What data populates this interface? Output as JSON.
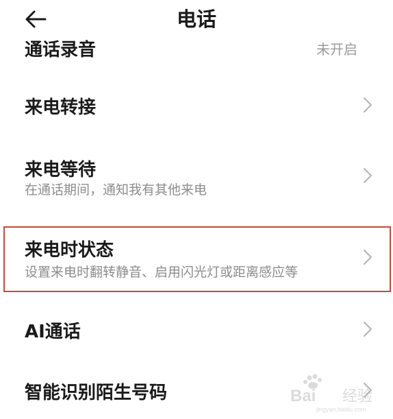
{
  "header": {
    "title": "电话"
  },
  "partial_item": {
    "label": "通话录音",
    "value": "未开启"
  },
  "items": [
    {
      "title": "来电转接",
      "subtitle": ""
    },
    {
      "title": "来电等待",
      "subtitle": "在通话期间，通知我有其他来电"
    },
    {
      "title": "来电时状态",
      "subtitle": "设置来电时翻转静音、启用闪光灯或距离感应等"
    },
    {
      "title": "AI通话",
      "subtitle": ""
    },
    {
      "title": "智能识别陌生号码",
      "subtitle": ""
    }
  ],
  "watermark": {
    "brand": "Bai",
    "suffix": "经验",
    "url": "jingyan.baidu.com"
  },
  "colors": {
    "highlight_border": "#c8483a",
    "title_text": "#1a1a1a",
    "subtitle_text": "#8c8c8c",
    "chevron": "#b3b3b3"
  },
  "icons": {
    "back": "arrow-left-icon",
    "chevron": "chevron-right-icon"
  }
}
